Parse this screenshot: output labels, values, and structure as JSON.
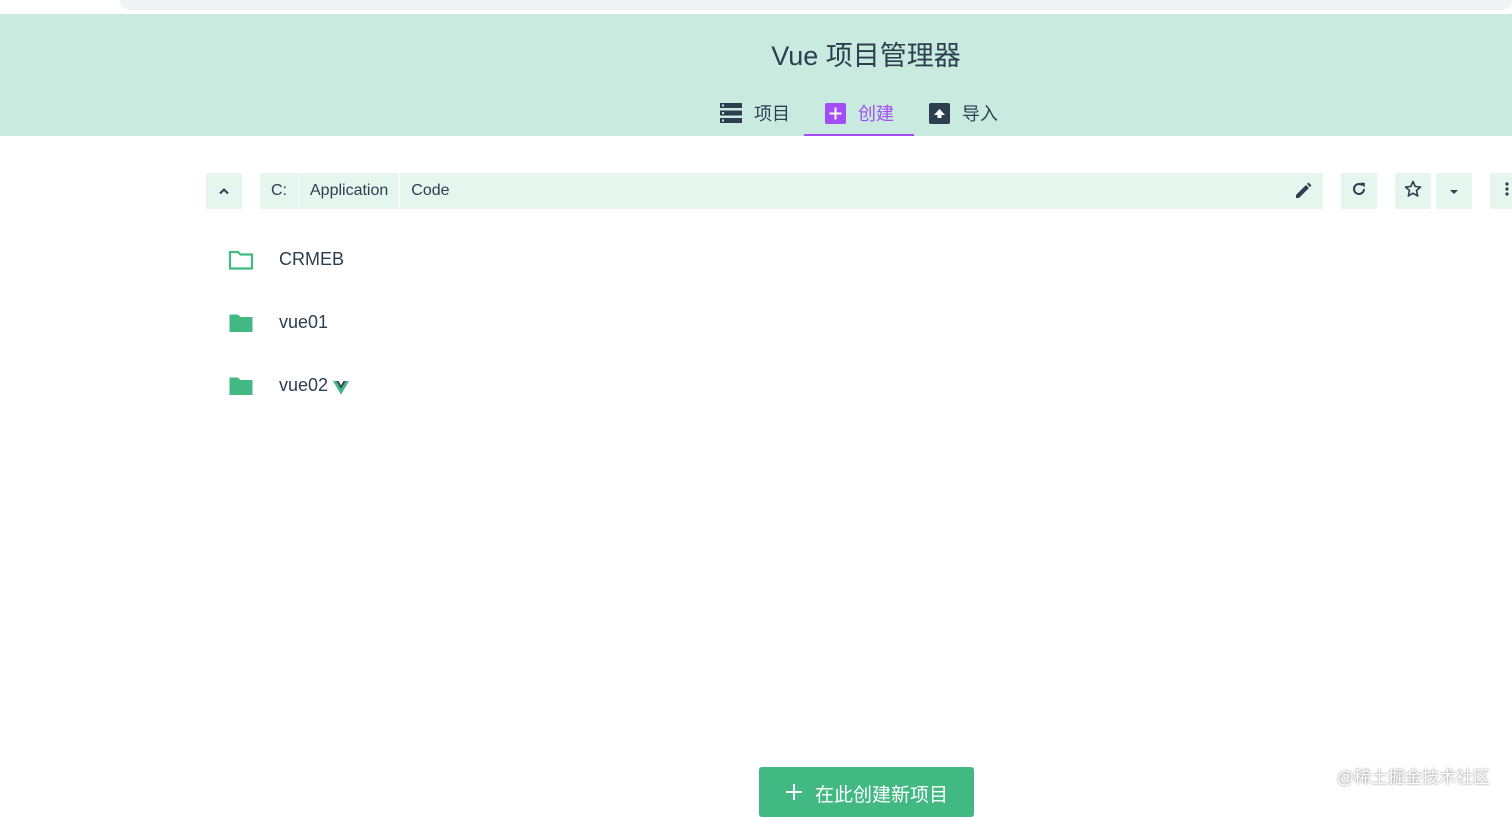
{
  "app": {
    "title": "Vue 项目管理器"
  },
  "tabs": [
    {
      "label": "项目",
      "icon": "list-icon",
      "active": false
    },
    {
      "label": "创建",
      "icon": "add-box-icon",
      "active": true
    },
    {
      "label": "导入",
      "icon": "import-icon",
      "active": false
    }
  ],
  "path": {
    "segments": [
      "C:",
      "Application",
      "Code"
    ]
  },
  "folders": [
    {
      "name": "CRMEB",
      "icon": "folder-outline-icon",
      "vue_project": false
    },
    {
      "name": "vue01",
      "icon": "folder-icon",
      "vue_project": false
    },
    {
      "name": "vue02",
      "icon": "folder-icon",
      "vue_project": true
    }
  ],
  "actions": {
    "create_label": "在此创建新项目"
  },
  "watermark": "@稀土掘金技术社区",
  "colors": {
    "header_bg": "#c9ebdf",
    "accent_green": "#42b983",
    "active_purple": "#a44cf6",
    "text": "#2c3e50",
    "toolbar_bg": "#e4f6ee"
  }
}
